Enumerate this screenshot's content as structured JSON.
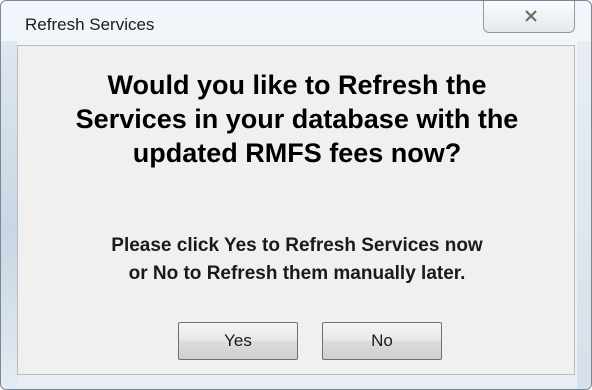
{
  "window": {
    "title": "Refresh Services"
  },
  "dialog": {
    "heading_line1": "Would you like to Refresh the",
    "heading_line2": "Services in your database with the",
    "heading_line3": "updated RMFS fees now?",
    "message_line1": "Please click Yes to Refresh Services now",
    "message_line2": "or No to Refresh them manually later."
  },
  "buttons": {
    "yes_label": "Yes",
    "no_label": "No"
  },
  "icons": {
    "close": "close-icon"
  }
}
